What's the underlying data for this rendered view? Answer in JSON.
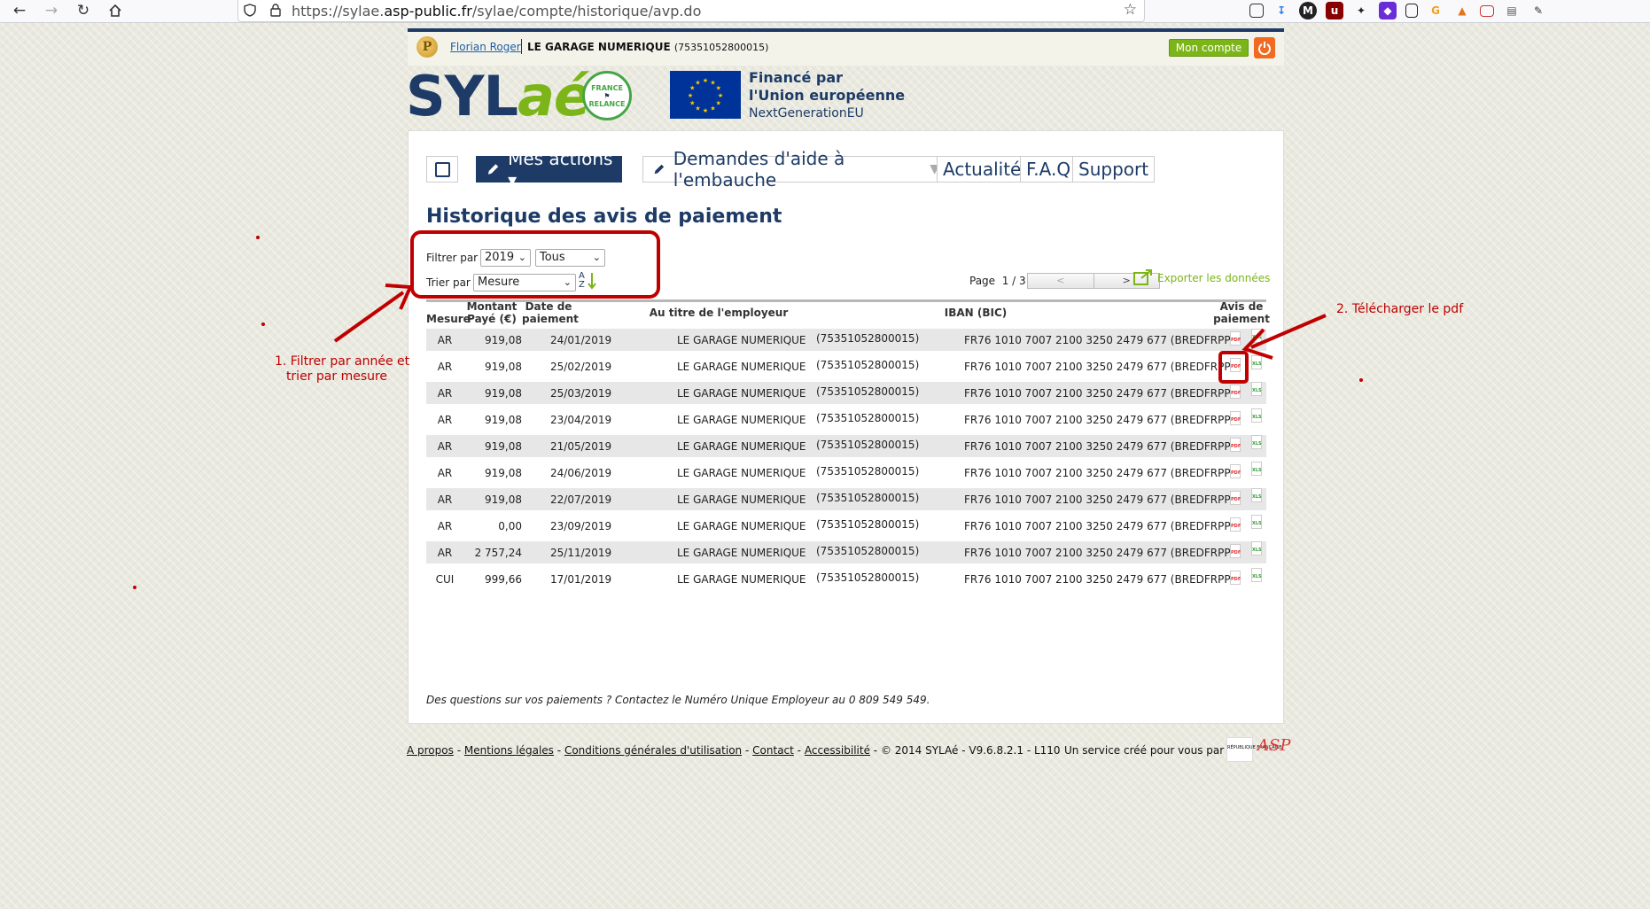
{
  "browser": {
    "url_prefix": "https://sylae.",
    "url_domain": "asp-public.fr",
    "url_path": "/sylae/compte/historique/avp.do"
  },
  "header": {
    "user_name": "Florian Roger",
    "company_name": "LE GARAGE NUMERIQUE",
    "company_siret": "(75351052800015)",
    "account_button": "Mon compte"
  },
  "logos": {
    "sylae_part1": "SYL",
    "sylae_part2": "aé",
    "relance_top": "FRANCE",
    "relance_bottom": "RELANCE",
    "eu_line1": "Financé par",
    "eu_line2": "l'Union européenne",
    "eu_line3": "NextGenerationEU"
  },
  "menu": {
    "actions": "Mes actions ▾",
    "demandes": "Demandes d'aide à l'embauche",
    "caret": "▼",
    "actualites": "Actualités",
    "faq": "F.A.Q",
    "support": "Support"
  },
  "page": {
    "title": "Historique des avis de paiement",
    "filter_label": "Filtrer par :",
    "filter_year": "2019",
    "filter_type": "Tous",
    "sort_label": "Trier par :",
    "sort_value": "Mesure",
    "sort_icon_top": "A",
    "sort_icon_bottom": "Z",
    "page_label": "Page",
    "page_value": "1 / 3",
    "prev": "<",
    "next": ">",
    "export": "Exporter les données",
    "note": "Des questions sur vos paiements ? Contactez le Numéro Unique Employeur au 0 809 549 549."
  },
  "table": {
    "headers": {
      "mesure": "Mesure",
      "montant_1": "Montant",
      "montant_2": "Payé (€)",
      "date_1": "Date de",
      "date_2": "paiement",
      "employeur": "Au titre de l'employeur",
      "iban": "IBAN (BIC)",
      "avis_1": "Avis de",
      "avis_2": "paiement"
    },
    "pdf_label": "PDF",
    "xls_label": "XLS",
    "rows": [
      {
        "mesure": "AR",
        "montant": "919,08",
        "date": "24/01/2019",
        "employeur": "LE GARAGE NUMERIQUE",
        "siret": "(75351052800015)",
        "iban": "FR76 1010 7007 2100 3250 2479 677 (BREDFRPP)"
      },
      {
        "mesure": "AR",
        "montant": "919,08",
        "date": "25/02/2019",
        "employeur": "LE GARAGE NUMERIQUE",
        "siret": "(75351052800015)",
        "iban": "FR76 1010 7007 2100 3250 2479 677 (BREDFRPP)"
      },
      {
        "mesure": "AR",
        "montant": "919,08",
        "date": "25/03/2019",
        "employeur": "LE GARAGE NUMERIQUE",
        "siret": "(75351052800015)",
        "iban": "FR76 1010 7007 2100 3250 2479 677 (BREDFRPP)"
      },
      {
        "mesure": "AR",
        "montant": "919,08",
        "date": "23/04/2019",
        "employeur": "LE GARAGE NUMERIQUE",
        "siret": "(75351052800015)",
        "iban": "FR76 1010 7007 2100 3250 2479 677 (BREDFRPP)"
      },
      {
        "mesure": "AR",
        "montant": "919,08",
        "date": "21/05/2019",
        "employeur": "LE GARAGE NUMERIQUE",
        "siret": "(75351052800015)",
        "iban": "FR76 1010 7007 2100 3250 2479 677 (BREDFRPP)"
      },
      {
        "mesure": "AR",
        "montant": "919,08",
        "date": "24/06/2019",
        "employeur": "LE GARAGE NUMERIQUE",
        "siret": "(75351052800015)",
        "iban": "FR76 1010 7007 2100 3250 2479 677 (BREDFRPP)"
      },
      {
        "mesure": "AR",
        "montant": "919,08",
        "date": "22/07/2019",
        "employeur": "LE GARAGE NUMERIQUE",
        "siret": "(75351052800015)",
        "iban": "FR76 1010 7007 2100 3250 2479 677 (BREDFRPP)"
      },
      {
        "mesure": "AR",
        "montant": "0,00",
        "date": "23/09/2019",
        "employeur": "LE GARAGE NUMERIQUE",
        "siret": "(75351052800015)",
        "iban": "FR76 1010 7007 2100 3250 2479 677 (BREDFRPP)"
      },
      {
        "mesure": "AR",
        "montant": "2 757,24",
        "date": "25/11/2019",
        "employeur": "LE GARAGE NUMERIQUE",
        "siret": "(75351052800015)",
        "iban": "FR76 1010 7007 2100 3250 2479 677 (BREDFRPP)"
      },
      {
        "mesure": "CUI",
        "montant": "999,66",
        "date": "17/01/2019",
        "employeur": "LE GARAGE NUMERIQUE",
        "siret": "(75351052800015)",
        "iban": "FR76 1010 7007 2100 3250 2479 677 (BREDFRPP)"
      }
    ]
  },
  "footer": {
    "apropos": "A propos",
    "mentions": "Mentions légales",
    "cgu": "Conditions générales d'utilisation",
    "contact": "Contact",
    "accessibilite": "Accessibilité",
    "dash": "-",
    "copyright": "- © 2014 SYLAé - V9.6.8.2.1 - L110",
    "service": "Un service créé pour vous par :",
    "rf_text": "RÉPUBLIQUE FRANÇAISE",
    "asp_text": "ASP"
  },
  "annotations": {
    "note1_line1": "1. Filtrer par année et",
    "note1_line2": "trier par mesure",
    "note2": "2. Télécharger le pdf"
  },
  "colors": {
    "navy": "#1d3b66",
    "green": "#7cb518",
    "annotation": "#c00000"
  }
}
